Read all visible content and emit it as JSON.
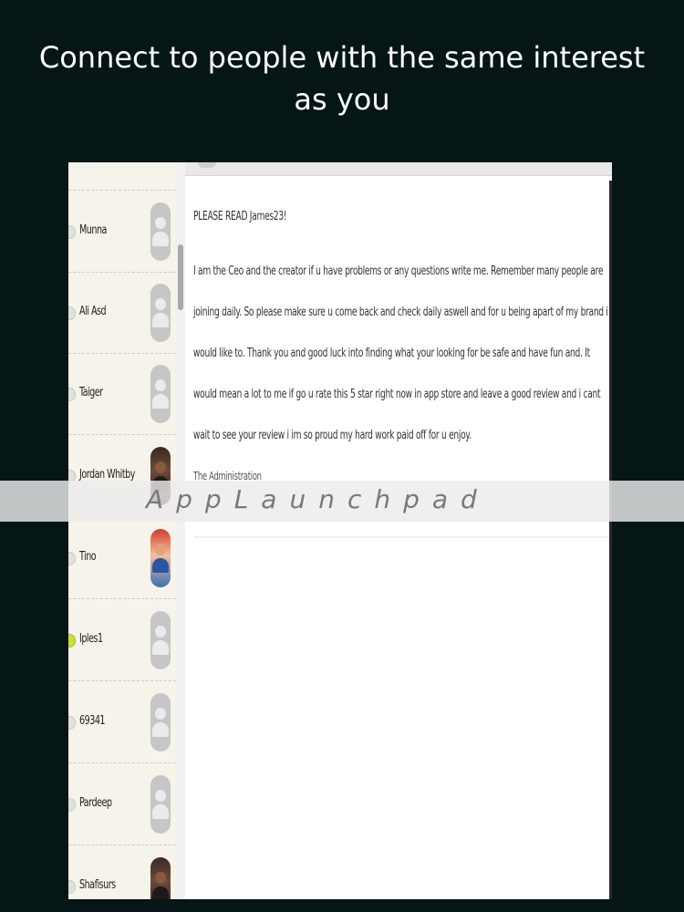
{
  "headline": {
    "line1": "Connect to people with the same interest",
    "line2": "as you"
  },
  "sidebar": {
    "contacts": [
      {
        "name": "Munna",
        "status": "offline",
        "avatar": "default-avatar-icon"
      },
      {
        "name": "Ali Asd",
        "status": "offline",
        "avatar": "default-avatar-icon"
      },
      {
        "name": "Taiger",
        "status": "offline",
        "avatar": "default-avatar-icon"
      },
      {
        "name": "Jordan Whitby",
        "status": "offline",
        "avatar": "photo"
      },
      {
        "name": "Tino",
        "status": "offline",
        "avatar": "photo"
      },
      {
        "name": "Iples1",
        "status": "online",
        "avatar": "default-avatar-icon"
      },
      {
        "name": "69341",
        "status": "offline",
        "avatar": "default-avatar-icon"
      },
      {
        "name": "Pardeep",
        "status": "offline",
        "avatar": "default-avatar-icon"
      },
      {
        "name": "Shafisurs",
        "status": "offline",
        "avatar": "photo"
      }
    ]
  },
  "message": {
    "header": "PLEASE READ  James23!",
    "lines": [
      "I am the Ceo and the creator if u have problems or any questions write me. Remember many people are",
      "joining daily. So please make sure u come back and check daily aswell and for u being apart of my brand i",
      "would like to. Thank you and good luck into finding what your looking for be safe and have fun and. It",
      "would mean a lot to me if go u rate this 5 star right now in app store and leave a good review and i cant",
      "wait to see your review i im so proud my hard work paid off for u enjoy."
    ],
    "signature": "The Administration"
  },
  "watermark": "AppLaunchpad",
  "colors": {
    "background": "#061616",
    "sidebar": "#f6f4ea",
    "online": "#c6e23a"
  }
}
